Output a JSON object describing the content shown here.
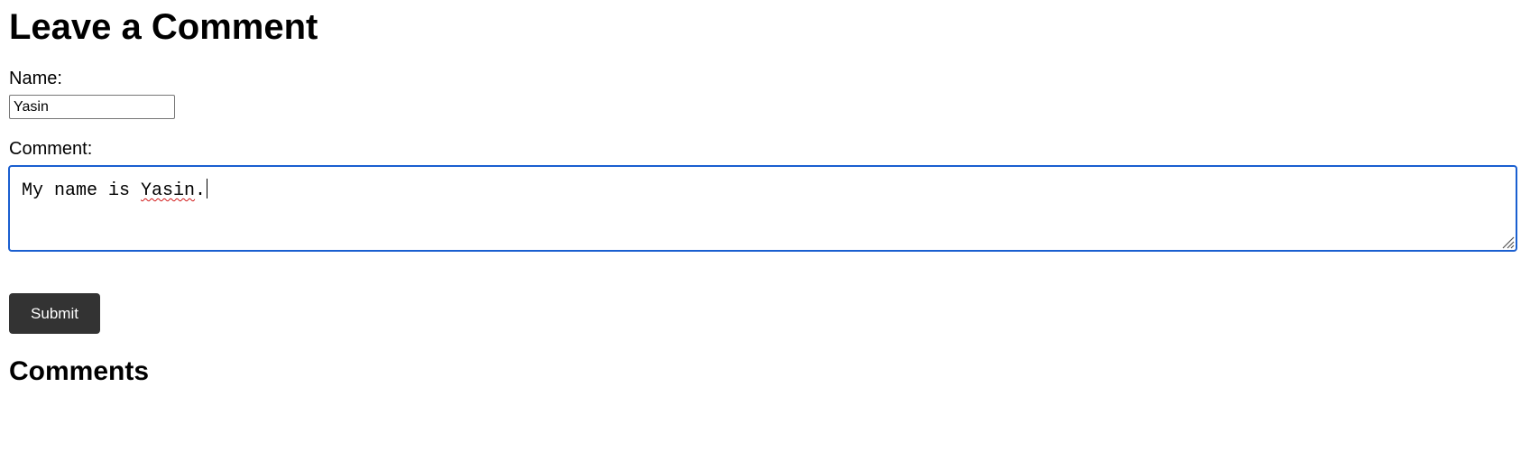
{
  "page": {
    "title": "Leave a Comment"
  },
  "form": {
    "name_label": "Name:",
    "name_value": "Yasin",
    "comment_label": "Comment:",
    "comment_text_before": "My name is ",
    "comment_text_misspelled": "Yasin",
    "comment_text_after": ".",
    "submit_label": "Submit"
  },
  "comments": {
    "heading": "Comments"
  },
  "colors": {
    "focus_border": "#1a5fd0",
    "button_bg": "#333333",
    "button_text": "#ffffff",
    "spellcheck_underline": "#d11a1a"
  }
}
